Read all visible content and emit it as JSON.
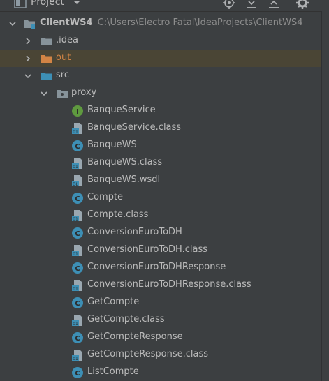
{
  "header": {
    "title": "Project",
    "icons": [
      "project-icon",
      "dropdown-arrow-icon",
      "locate-icon",
      "expand-all-icon",
      "collapse-all-icon",
      "gear-icon"
    ]
  },
  "tree": {
    "root": {
      "name": "ClientWS4",
      "path": "C:\\Users\\Electro Fatal\\IdeaProjects\\ClientWS4"
    },
    "idea": {
      "name": ".idea"
    },
    "out": {
      "name": "out"
    },
    "src": {
      "name": "src"
    },
    "proxy": {
      "name": "proxy"
    },
    "files": [
      {
        "name": "BanqueService",
        "type": "interface"
      },
      {
        "name": "BanqueService.class",
        "type": "class-file"
      },
      {
        "name": "BanqueWS",
        "type": "class"
      },
      {
        "name": "BanqueWS.class",
        "type": "class-file"
      },
      {
        "name": "BanqueWS.wsdl",
        "type": "wsdl-file"
      },
      {
        "name": "Compte",
        "type": "class"
      },
      {
        "name": "Compte.class",
        "type": "class-file"
      },
      {
        "name": "ConversionEuroToDH",
        "type": "class"
      },
      {
        "name": "ConversionEuroToDH.class",
        "type": "class-file"
      },
      {
        "name": "ConversionEuroToDHResponse",
        "type": "class"
      },
      {
        "name": "ConversionEuroToDHResponse.class",
        "type": "class-file"
      },
      {
        "name": "GetCompte",
        "type": "class"
      },
      {
        "name": "GetCompte.class",
        "type": "class-file"
      },
      {
        "name": "GetCompteResponse",
        "type": "class"
      },
      {
        "name": "GetCompteResponse.class",
        "type": "class-file"
      },
      {
        "name": "ListCompte",
        "type": "class"
      }
    ]
  },
  "colors": {
    "background": "#3c3f41",
    "text": "#bbbbbb",
    "path_text": "#8d8d8d",
    "excluded_text": "#d28445",
    "excluded_row": "#4a4535",
    "class_icon": "#3d8fb5",
    "interface_icon": "#5f9a3f",
    "folder": "#87939a",
    "source_folder": "#3d8fb5",
    "excluded_folder": "#d28445"
  }
}
